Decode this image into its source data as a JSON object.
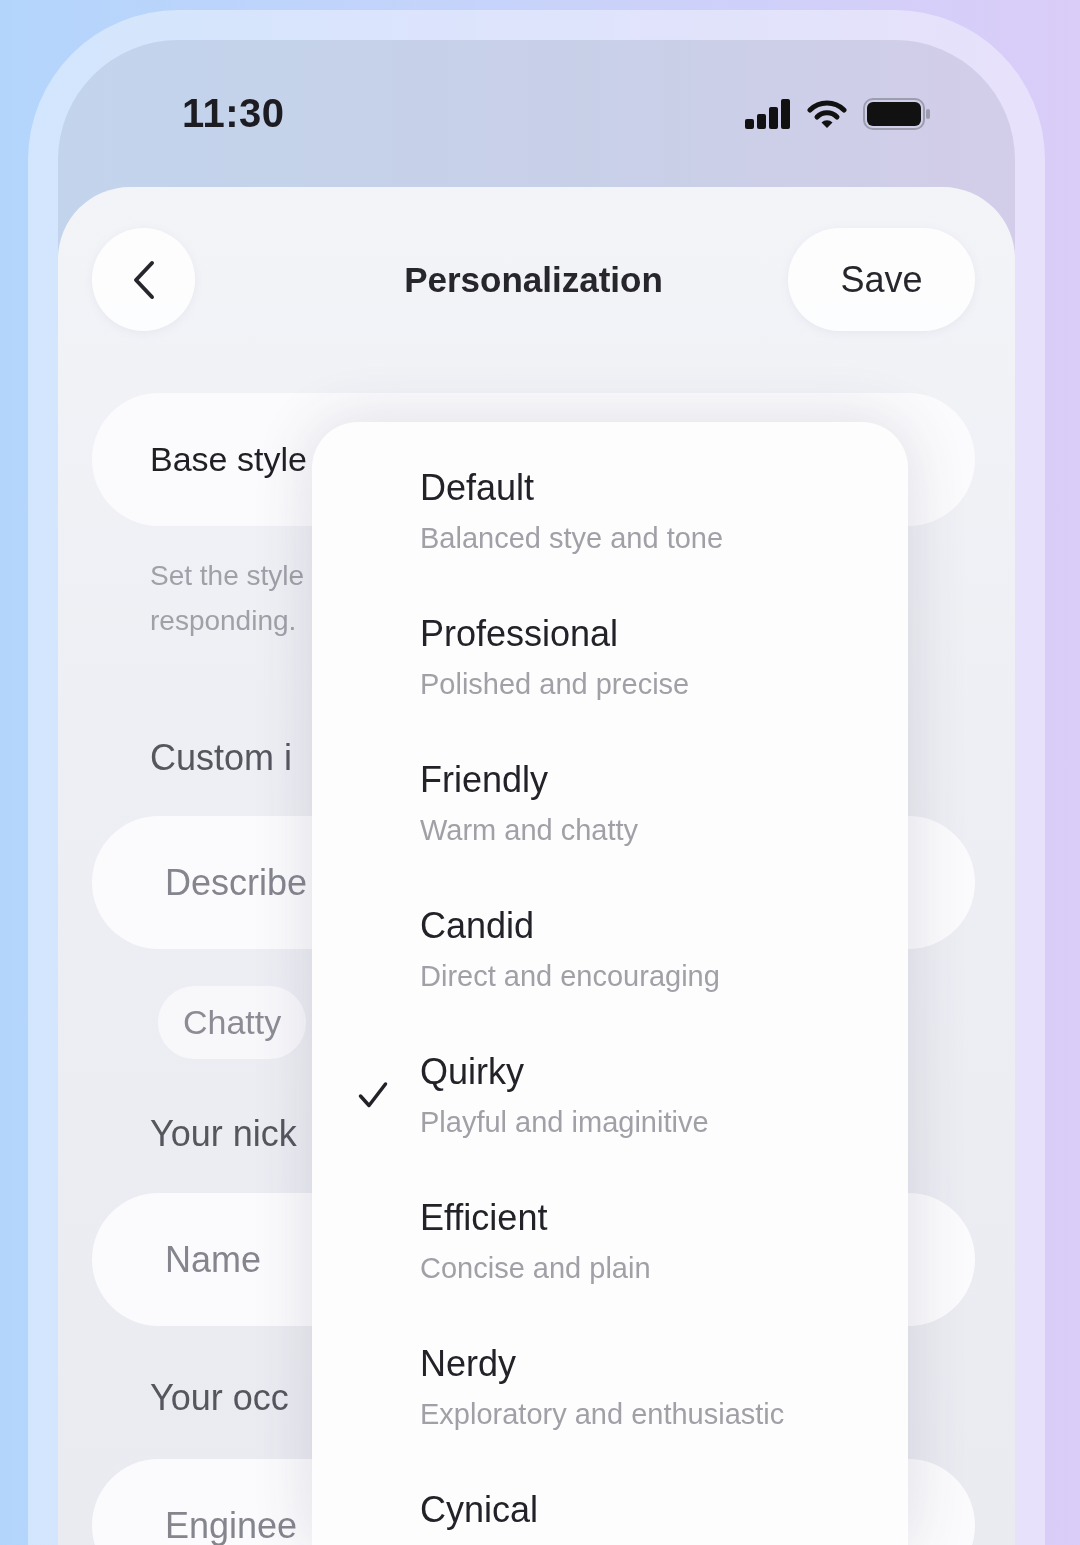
{
  "status_bar": {
    "time": "11:30"
  },
  "header": {
    "title": "Personalization",
    "save_button": "Save"
  },
  "base_style": {
    "label": "Base style",
    "help_text_lines": [
      "Set the style",
      "responding."
    ]
  },
  "custom_instructions": {
    "label": "Custom i",
    "field": {
      "placeholder": "Describe"
    },
    "chips": [
      {
        "label": "Chatty"
      }
    ]
  },
  "nickname": {
    "label": "Your nick",
    "field": {
      "placeholder": "Name"
    }
  },
  "occupation": {
    "label": "Your occ",
    "field": {
      "placeholder": "Enginee"
    }
  },
  "style_menu": {
    "items": [
      {
        "title": "Default",
        "description": "Balanced stye and tone",
        "selected": false
      },
      {
        "title": "Professional",
        "description": "Polished and precise",
        "selected": false
      },
      {
        "title": "Friendly",
        "description": "Warm and chatty",
        "selected": false
      },
      {
        "title": "Candid",
        "description": "Direct and encouraging",
        "selected": false
      },
      {
        "title": "Quirky",
        "description": "Playful and imaginitive",
        "selected": true
      },
      {
        "title": "Efficient",
        "description": "Concise and plain",
        "selected": false
      },
      {
        "title": "Nerdy",
        "description": "Exploratory and enthusiastic",
        "selected": false
      },
      {
        "title": "Cynical",
        "selected": false
      }
    ]
  }
}
